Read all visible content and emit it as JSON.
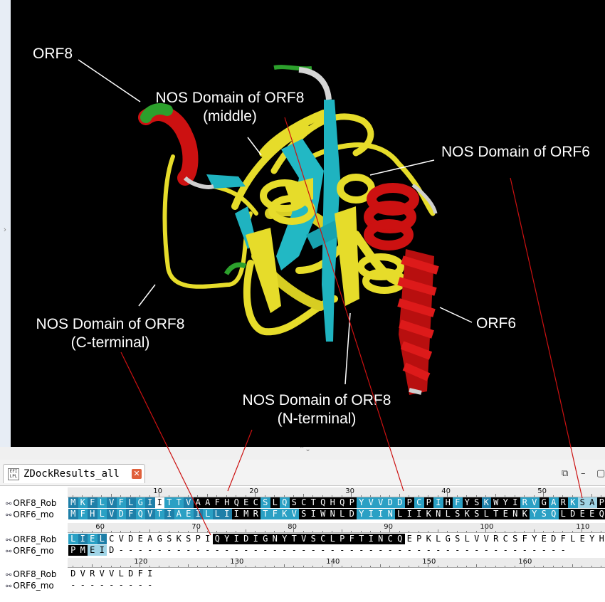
{
  "viewer": {
    "labels": {
      "orf8": "ORF8",
      "nos_middle_l1": "NOS Domain of ORF8",
      "nos_middle_l2": "(middle)",
      "nos_orf6": "NOS Domain of ORF6",
      "nos_c_l1": "NOS Domain of ORF8",
      "nos_c_l2": "(C-terminal)",
      "orf6": "ORF6",
      "nos_n_l1": "NOS Domain of ORF8",
      "nos_n_l2": "(N-terminal)"
    },
    "colors": {
      "background": "#000000",
      "helix": "#cc1111",
      "sheet": "#1fb3c0",
      "coil": "#e6dc2a",
      "turn": "#d0d0d0",
      "green": "#2ca02c",
      "pointer_line": "#cc1111"
    }
  },
  "tab": {
    "title": "ZDockResults_all",
    "icon": "file-icon",
    "icon_text": "EFI LPL",
    "close_icon": "close-icon"
  },
  "window_buttons": [
    "restore-icon",
    "minimize-icon",
    "maximize-icon"
  ],
  "alignment": {
    "names": [
      "ORF8_Rob",
      "ORF6_mo",
      "ORF8_Rob",
      "ORF6_mo",
      "ORF8_Rob",
      "ORF6_mo"
    ],
    "block1": {
      "ruler": [
        "10",
        "20",
        "30",
        "40",
        "50"
      ],
      "orf8": "MKFLVFLGIITTVAAFHQECSLQSCTQHQPYVVDDPCPIHFYSKWYIRVGARKSAP",
      "orf6": "MFHLVDFQVTIAEILLIIMRTFKVSIWNLDYIINLIIKNLSKSLTENKYSQLDEEQ"
    },
    "block2": {
      "ruler": [
        "60",
        "70",
        "80",
        "90",
        "100",
        "110"
      ],
      "orf8": "LIELCVDEAGSKSPIQYIDIGNYTVSCLPFTINCQEPKLGSLVVRCSFYEDFLEYH",
      "orf6": "PMEID-----------------------------------------------"
    },
    "block3": {
      "ruler": [
        "120",
        "130",
        "140",
        "150",
        "160"
      ],
      "orf8": "DVRVVLDFI",
      "orf6": "---------"
    }
  }
}
